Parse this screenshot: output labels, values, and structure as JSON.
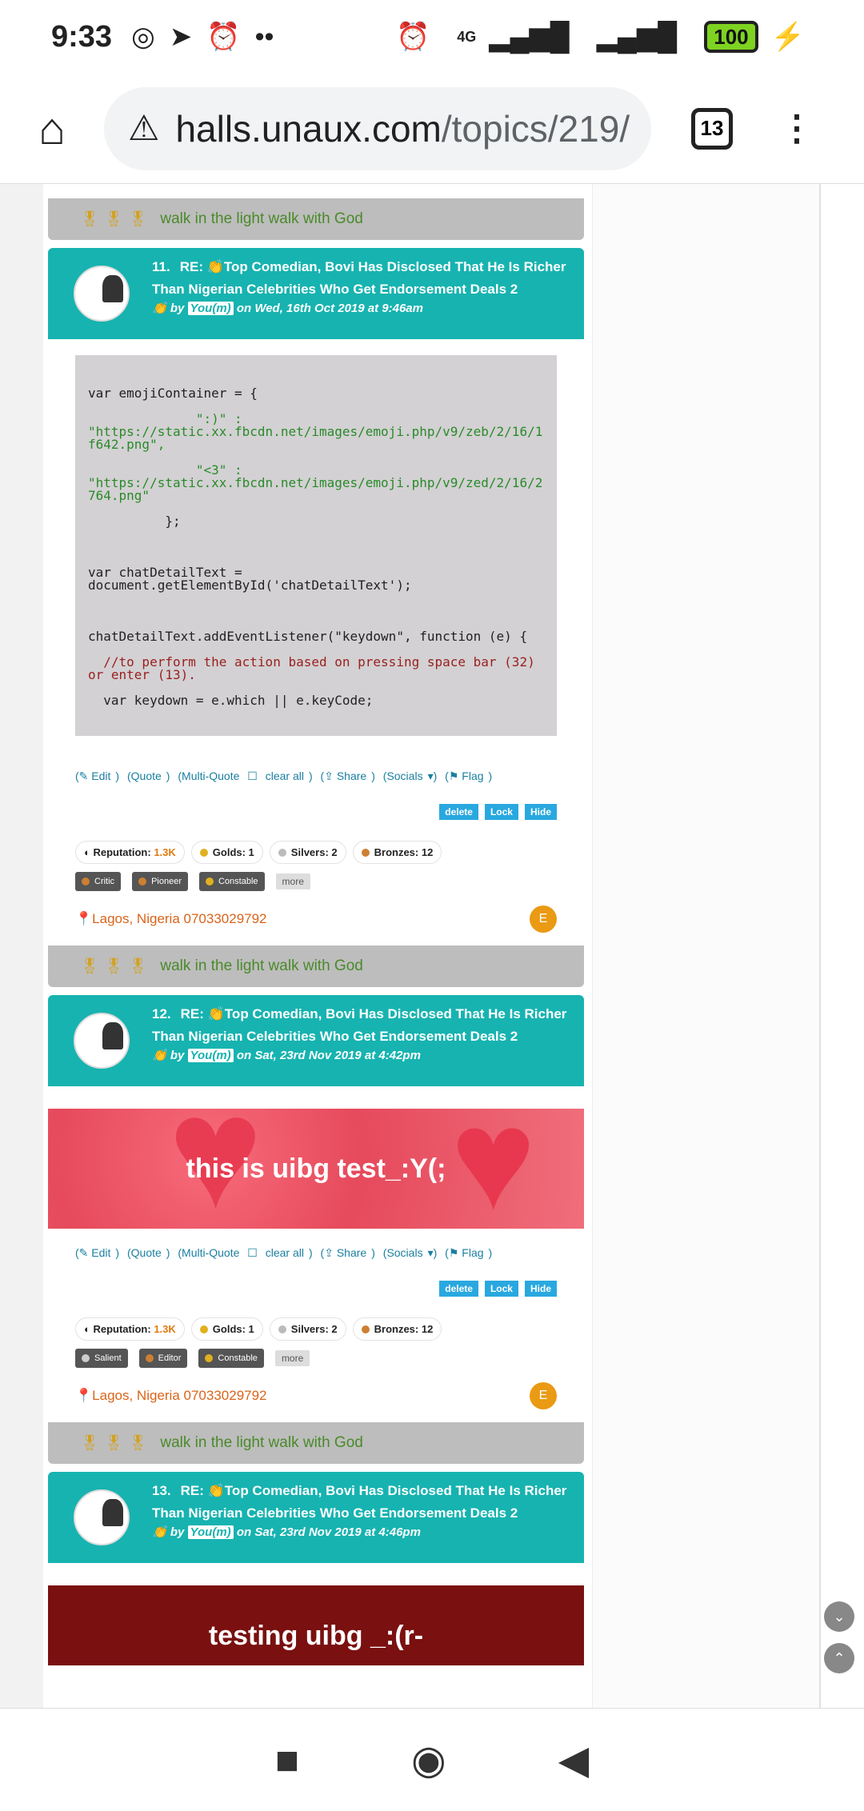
{
  "status_bar": {
    "time": "9:33",
    "network": "4G",
    "battery": "100"
  },
  "browser": {
    "url_host": "halls.unaux.com",
    "url_path": "/topics/219/",
    "tab_count": "13"
  },
  "signature": "walk in the light walk with God",
  "posts": [
    {
      "num": "11.",
      "title": "RE: 👏Top Comedian, Bovi Has Disclosed That He Is Richer Than Nigerian Celebrities Who Get Endorsement Deals 2",
      "by": "by",
      "user": "You(m)",
      "date": "on Wed, 16th Oct 2019 at 9:46am",
      "code_lines": [
        "var emojiContainer = {",
        "",
        "              \":)\" :",
        "\"https://static.xx.fbcdn.net/images/emoji.php/v9/zeb/2/16/1f642.png\",",
        "",
        "              \"<3\" :",
        "\"https://static.xx.fbcdn.net/images/emoji.php/v9/zed/2/16/2764.png\"",
        "",
        "          };",
        "",
        "",
        "",
        "var chatDetailText =",
        "document.getElementById('chatDetailText');",
        "",
        "",
        "",
        "chatDetailText.addEventListener(\"keydown\", function (e) {",
        "",
        "  //to perform the action based on pressing space bar (32) or enter (13).",
        "",
        "  var keydown = e.which || e.keyCode;"
      ],
      "badges": [
        "Critic",
        "Pioneer",
        "Constable"
      ]
    },
    {
      "num": "12.",
      "title": "RE: 👏Top Comedian, Bovi Has Disclosed That He Is Richer Than Nigerian Celebrities Who Get Endorsement Deals 2",
      "by": "by",
      "user": "You(m)",
      "date": "on Sat, 23rd Nov 2019 at 4:42pm",
      "banner": "this is uibg test_:Y(;",
      "badges": [
        "Salient",
        "Editor",
        "Constable"
      ]
    },
    {
      "num": "13.",
      "title": "RE: 👏Top Comedian, Bovi Has Disclosed That He Is Richer Than Nigerian Celebrities Who Get Endorsement Deals 2",
      "by": "by",
      "user": "You(m)",
      "date": "on Sat, 23rd Nov 2019 at 4:46pm",
      "banner": "testing uibg _:(r-"
    }
  ],
  "actions": {
    "edit": "Edit",
    "quote": "Quote",
    "multi_quote": "Multi-Quote",
    "clear_all": "clear all",
    "share": "Share",
    "socials": "Socials",
    "flag": "Flag"
  },
  "admin": {
    "delete": "delete",
    "lock": "Lock",
    "hide": "Hide"
  },
  "stats": {
    "reputation_label": "Reputation:",
    "reputation": "1.3K",
    "golds": "Golds: 1",
    "silvers": "Silvers: 2",
    "bronzes": "Bronzes: 12"
  },
  "more": "more",
  "location": "Lagos, Nigeria 07033029792",
  "avatar_letter": "E",
  "colors": {
    "post_header": "#17b3b0",
    "link": "#1a7fa0",
    "location": "#d9641a",
    "admin_button": "#29a8e0"
  }
}
